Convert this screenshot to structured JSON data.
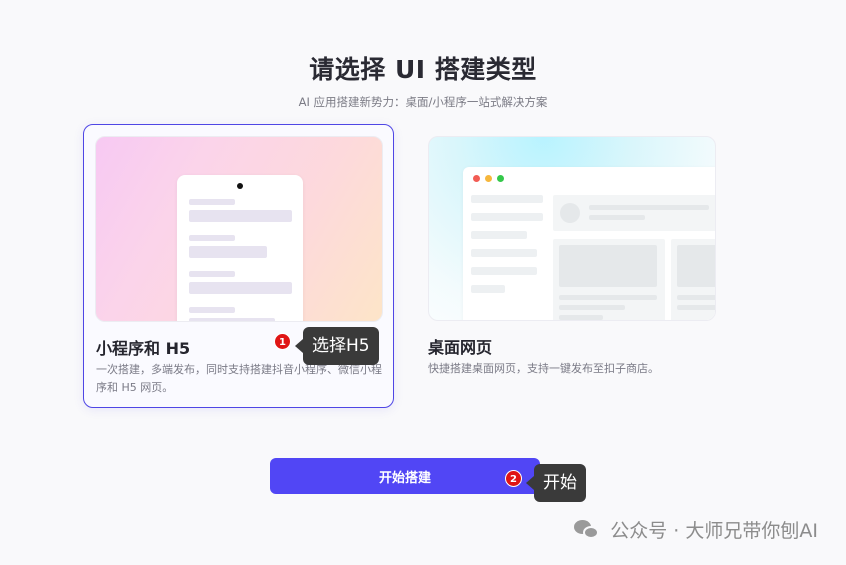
{
  "header": {
    "title": "请选择 UI 搭建类型",
    "subtitle": "AI 应用搭建新势力：桌面/小程序一站式解决方案"
  },
  "cards": [
    {
      "title": "小程序和 H5",
      "description": "一次搭建，多端发布，同时支持搭建抖音小程序、微信小程序和 H5 网页。",
      "selected": true
    },
    {
      "title": "桌面网页",
      "description": "快捷搭建桌面网页，支持一键发布至扣子商店。",
      "selected": false
    }
  ],
  "annotations": [
    {
      "number": "1",
      "label": "选择H5"
    },
    {
      "number": "2",
      "label": "开始"
    }
  ],
  "start_button": {
    "label": "开始搭建"
  },
  "watermark": {
    "text": "公众号 · 大师兄带你刨AI"
  },
  "colors": {
    "accent": "#5146f5",
    "selected_border": "#4f46e5",
    "badge": "#e01515",
    "tooltip_bg": "#3a3a3a"
  },
  "icons": {
    "wechat": "wechat-icon",
    "notch": "phone-notch"
  }
}
